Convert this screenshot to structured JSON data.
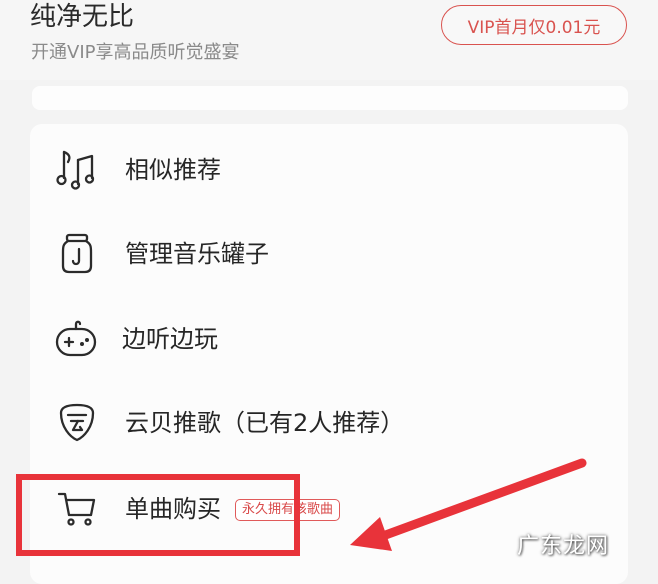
{
  "vip": {
    "title": "纯净无比",
    "subtitle": "开通VIP享高品质听觉盛宴",
    "button_label": "VIP首月仅0.01元"
  },
  "menu": {
    "items": [
      {
        "label": "相似推荐",
        "icon": "music-notes-icon"
      },
      {
        "label": "管理音乐罐子",
        "icon": "music-jar-icon"
      },
      {
        "label": "边听边玩",
        "icon": "gamepad-icon"
      },
      {
        "label": "云贝推歌（已有2人推荐）",
        "icon": "cloud-shell-icon"
      },
      {
        "label": "单曲购买",
        "icon": "cart-icon",
        "badge": "永久拥有该歌曲"
      }
    ]
  },
  "watermark": "广东龙网",
  "colors": {
    "accent": "#d9534f",
    "annotation_red": "#e8333a",
    "text_dark": "#262626",
    "text_muted": "#8a8a8a"
  }
}
